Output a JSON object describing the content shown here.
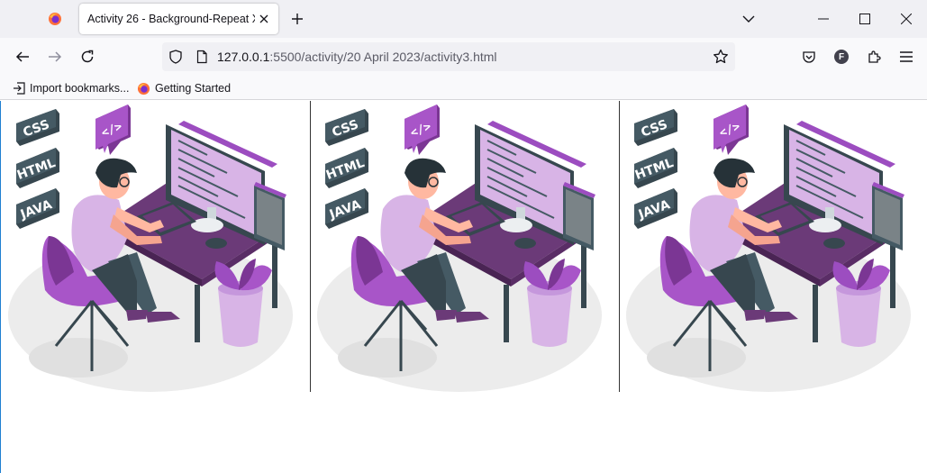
{
  "browser": {
    "tab": {
      "title": "Activity 26 - Background-Repeat X"
    },
    "window_controls": [
      "minimize",
      "maximize",
      "close"
    ],
    "url": {
      "host": "127.0.0.1",
      "rest": ":5500/activity/20 April 2023/activity3.html"
    },
    "bookmarks": [
      {
        "label": "Import bookmarks...",
        "icon": "import-icon"
      },
      {
        "label": "Getting Started",
        "icon": "firefox-icon"
      }
    ],
    "profile_initial": "F"
  },
  "page": {
    "illustration": {
      "badges": [
        "CSS",
        "HTML",
        "JAVA"
      ],
      "code_bubble": "</>"
    },
    "repeat_count": 3,
    "colors": {
      "purple": "#9c4dc0",
      "dark_purple": "#6b3a78",
      "light_purple": "#d8b4e6",
      "slate": "#455a64"
    }
  }
}
